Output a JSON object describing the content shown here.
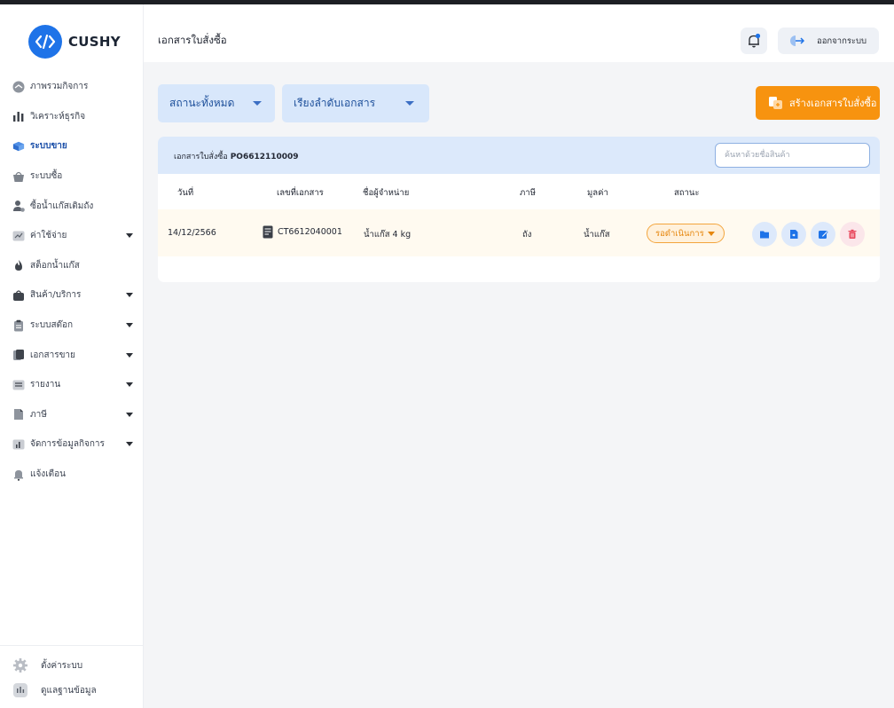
{
  "app": {
    "logo_text": "CUSHY"
  },
  "sidebar": {
    "items": [
      {
        "label": "ภาพรวมกิจการ",
        "icon": "overview-icon",
        "caret": false
      },
      {
        "label": "วิเคราะห์ธุรกิจ",
        "icon": "bar-chart-icon",
        "caret": false
      },
      {
        "label": "ระบบขาย",
        "icon": "box-icon",
        "caret": false,
        "active": true
      },
      {
        "label": "ระบบซื้อ",
        "icon": "basket-icon",
        "caret": false
      },
      {
        "label": "ซื้อน้ำแก๊สเติมถัง",
        "icon": "person-gas-icon",
        "caret": false
      },
      {
        "label": "ค่าใช้จ่าย",
        "icon": "expense-chart-icon",
        "caret": true
      },
      {
        "label": "สต็อกน้ำแก๊ส",
        "icon": "flame-icon",
        "caret": false
      },
      {
        "label": "สินค้า/บริการ",
        "icon": "bag-icon",
        "caret": true
      },
      {
        "label": "ระบบสต๊อก",
        "icon": "clipboard-icon",
        "caret": true
      },
      {
        "label": "เอกสารขาย",
        "icon": "documents-icon",
        "caret": true
      },
      {
        "label": "รายงาน",
        "icon": "report-icon",
        "caret": true
      },
      {
        "label": "ภาษี",
        "icon": "tax-file-icon",
        "caret": true
      },
      {
        "label": "จัดการข้อมูลกิจการ",
        "icon": "business-data-icon",
        "caret": true
      },
      {
        "label": "แจ้งเตือน",
        "icon": "alert-bell-icon",
        "caret": false
      }
    ],
    "bottom": [
      {
        "label": "ตั้งค่าระบบ",
        "icon": "gear-icon"
      },
      {
        "label": "ดูแลฐานข้อมูล",
        "icon": "database-icon"
      }
    ]
  },
  "header": {
    "title": "เอกสารใบสั่งซื้อ",
    "logout_label": "ออกจากระบบ"
  },
  "filters": {
    "status_label": "สถานะทั้งหมด",
    "sort_label": "เรียงลำดับเอกสาร"
  },
  "create_button_label": "สร้างเอกสารใบสั่งซื้อ",
  "card": {
    "po_prefix": "เอกสารใบสั่งซื้อ",
    "po_number": "PO6612110009",
    "search_placeholder": "ค้นหาด้วยชื่อสินค้า"
  },
  "table": {
    "headers": {
      "date": "วันที่",
      "doc_no": "เลขที่เอกสาร",
      "vendor": "ชื่อผู้จำหน่าย",
      "tax": "ภาษี",
      "value": "มูลค่า",
      "status": "สถานะ"
    },
    "rows": [
      {
        "date": "14/12/2566",
        "doc_no": "CT6612040001",
        "vendor": "น้ำแก๊ส 4 kg",
        "tax": "ถัง",
        "value": "น้ำแก๊ส",
        "status": "รอดำเนินการ"
      }
    ]
  },
  "colors": {
    "primary": "#1e73e8",
    "accent_orange": "#f7930f",
    "filter_bg": "#d8e7fb",
    "status_orange": "#e6860d"
  }
}
